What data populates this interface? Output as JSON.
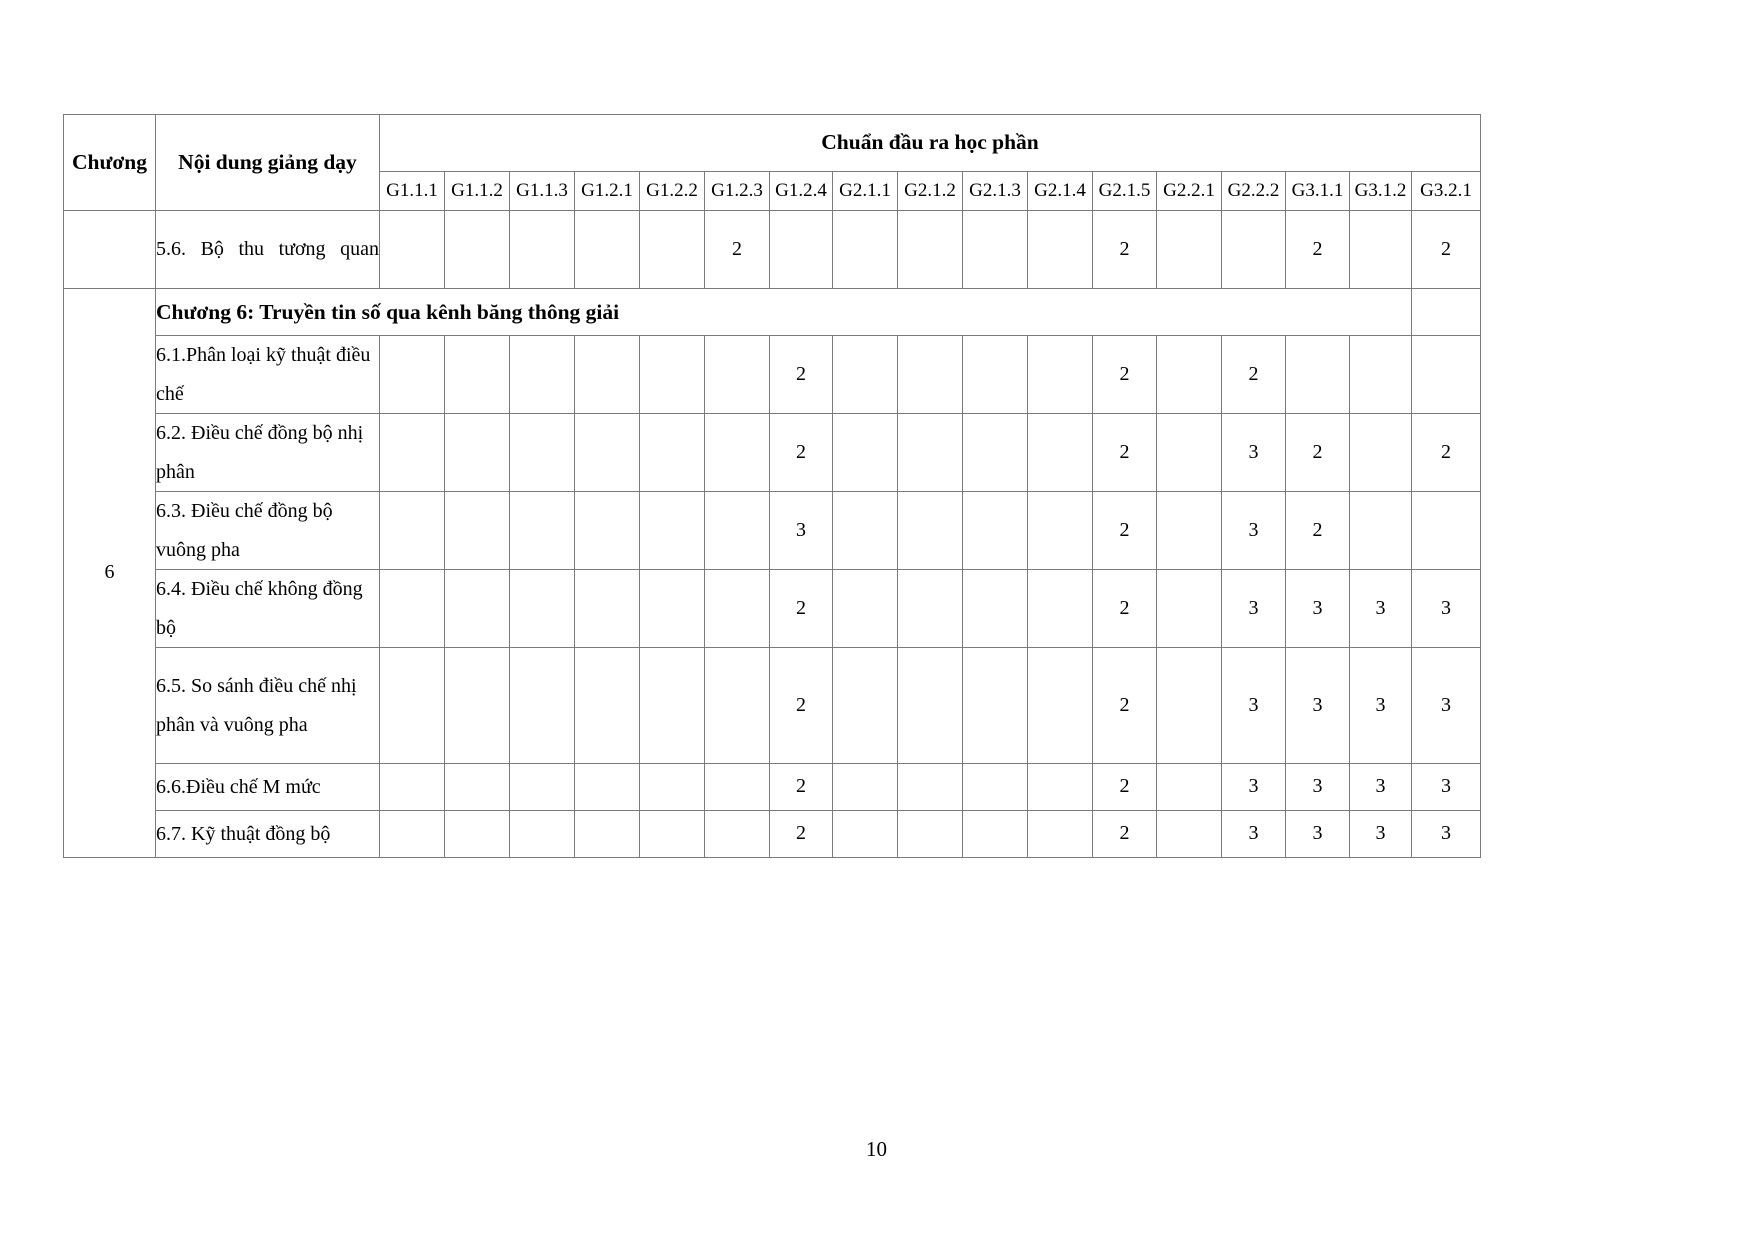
{
  "document": {
    "page_number": "10"
  },
  "table": {
    "header": {
      "col_chuong": "Chương",
      "col_noidung": "Nội dung giảng dạy",
      "group_label": "Chuẩn đầu ra học phần",
      "outcome_codes": [
        "G1.1.1",
        "G1.1.2",
        "G1.1.3",
        "G1.2.1",
        "G1.2.2",
        "G1.2.3",
        "G1.2.4",
        "G2.1.1",
        "G2.1.2",
        "G2.1.3",
        "G2.1.4",
        "G2.1.5",
        "G2.2.1",
        "G2.2.2",
        "G3.1.1",
        "G3.1.2",
        "G3.2.1"
      ]
    },
    "chapter_label": "6",
    "section_title": "Chương 6: Truyền tin số qua kênh băng thông giải",
    "rows": [
      {
        "chuong": "",
        "content": "5.6.  Bộ  thu  tương quan",
        "justify": true,
        "lines": 2,
        "values": [
          "",
          "",
          "",
          "",
          "",
          "2",
          "",
          "",
          "",
          "",
          "",
          "2",
          "",
          "",
          "2",
          "",
          "2"
        ]
      },
      {
        "chuong": "",
        "content": "6.1.Phân loại kỹ thuật điều chế",
        "justify": false,
        "lines": 2,
        "values": [
          "",
          "",
          "",
          "",
          "",
          "",
          "2",
          "",
          "",
          "",
          "",
          "2",
          "",
          "2",
          "",
          "",
          ""
        ]
      },
      {
        "chuong": "",
        "content": "6.2. Điều chế đồng bộ nhị phân",
        "justify": false,
        "lines": 2,
        "values": [
          "",
          "",
          "",
          "",
          "",
          "",
          "2",
          "",
          "",
          "",
          "",
          "2",
          "",
          "3",
          "2",
          "",
          "2"
        ]
      },
      {
        "chuong": "",
        "content": "6.3. Điều chế đồng bộ vuông pha",
        "justify": false,
        "lines": 2,
        "values": [
          "",
          "",
          "",
          "",
          "",
          "",
          "3",
          "",
          "",
          "",
          "",
          "2",
          "",
          "3",
          "2",
          "",
          ""
        ]
      },
      {
        "chuong": "",
        "content": "6.4. Điều chế không đồng bộ",
        "justify": false,
        "lines": 2,
        "values": [
          "",
          "",
          "",
          "",
          "",
          "",
          "2",
          "",
          "",
          "",
          "",
          "2",
          "",
          "3",
          "3",
          "3",
          "3"
        ]
      },
      {
        "chuong": "",
        "content": "6.5. So sánh điều chế nhị phân và vuông pha",
        "justify": false,
        "lines": 3,
        "values": [
          "",
          "",
          "",
          "",
          "",
          "",
          "2",
          "",
          "",
          "",
          "",
          "2",
          "",
          "3",
          "3",
          "3",
          "3"
        ]
      },
      {
        "chuong": "",
        "content": "6.6.Điều chế M mức",
        "justify": false,
        "lines": 1,
        "values": [
          "",
          "",
          "",
          "",
          "",
          "",
          "2",
          "",
          "",
          "",
          "",
          "2",
          "",
          "3",
          "3",
          "3",
          "3"
        ]
      },
      {
        "chuong": "",
        "content": "6.7. Kỹ thuật đồng bộ",
        "justify": false,
        "lines": 1,
        "values": [
          "",
          "",
          "",
          "",
          "",
          "",
          "2",
          "",
          "",
          "",
          "",
          "2",
          "",
          "3",
          "3",
          "3",
          "3"
        ]
      }
    ]
  }
}
